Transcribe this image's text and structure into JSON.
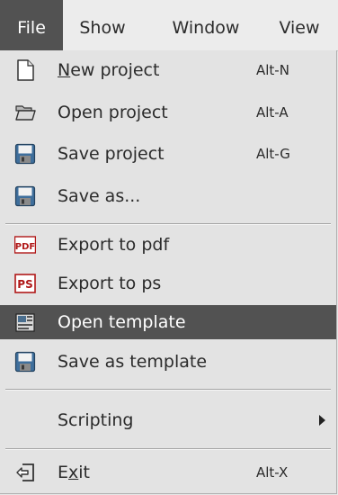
{
  "menubar": {
    "items": [
      {
        "label": "File",
        "active": true
      },
      {
        "label": "Show"
      },
      {
        "label": "Window"
      },
      {
        "label": "View"
      }
    ]
  },
  "file_menu": {
    "new_project": {
      "pre": "",
      "mnemonic": "N",
      "post": "ew project",
      "shortcut": "Alt-N",
      "icon": "new-document-icon"
    },
    "open_project": {
      "label": "Open project",
      "shortcut": "Alt-A",
      "icon": "folder-open-icon"
    },
    "save_project": {
      "label": "Save project",
      "shortcut": "Alt-G",
      "icon": "floppy-disk-icon"
    },
    "save_as": {
      "label": "Save as...",
      "icon": "floppy-disk-icon"
    },
    "export_pdf": {
      "label": "Export to pdf",
      "icon": "pdf-icon",
      "icon_text": "PDF"
    },
    "export_ps": {
      "label": "Export to ps",
      "icon": "ps-icon",
      "icon_text": "PS"
    },
    "open_template": {
      "label": "Open template",
      "icon": "template-icon",
      "active": true
    },
    "save_as_template": {
      "label": "Save as template",
      "icon": "floppy-disk-icon"
    },
    "scripting": {
      "label": "Scripting",
      "has_submenu": true
    },
    "exit": {
      "pre": "E",
      "mnemonic": "x",
      "post": "it",
      "shortcut": "Alt-X",
      "icon": "exit-icon"
    }
  },
  "colors": {
    "highlight": "#525252",
    "menu_bg": "#e3e3e3",
    "text": "#2b2b2b"
  }
}
